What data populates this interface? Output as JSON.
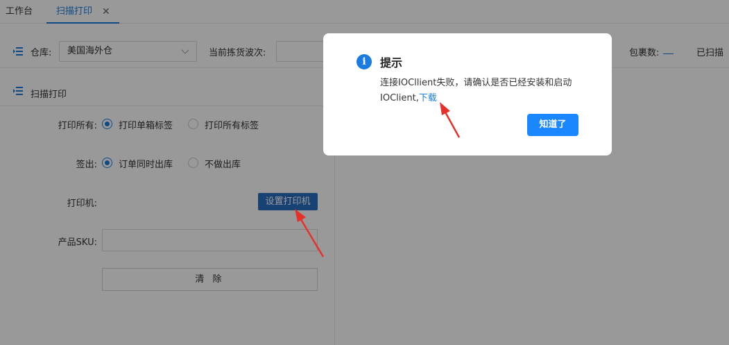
{
  "tabs": [
    {
      "label": "工作台"
    },
    {
      "label": "扫描打印",
      "close": "✕"
    }
  ],
  "filter": {
    "warehouse_label": "仓库:",
    "warehouse_value": "美国海外仓",
    "wave_label": "当前拣货波次:",
    "package_label": "包裹数:",
    "scanned_label": "已扫描"
  },
  "panel": {
    "title": "扫描打印",
    "print_all_label": "打印所有:",
    "print_options": [
      "打印单箱标签",
      "打印所有标签"
    ],
    "print_selected": "打印单箱标签",
    "checkout_label": "签出:",
    "checkout_options": [
      "订单同时出库",
      "不做出库"
    ],
    "checkout_selected": "订单同时出库",
    "printer_label": "打印机:",
    "printer_button": "设置打印机",
    "sku_label": "产品SKU:",
    "sku_value": "",
    "clear_button": "清 除"
  },
  "dialog": {
    "icon": "i",
    "title": "提示",
    "message": "连接IOCllient失败，请确认是否已经安装和启动IOClient,",
    "link": "下载",
    "ok_button": "知道了"
  },
  "colors": {
    "accent": "#1a7ce0",
    "ok_button": "#1a86ff",
    "printer_button": "#2b6fc2",
    "annotation_arrow": "#e8302a"
  },
  "icons": [
    "menu-icon",
    "chevron-down-icon",
    "close-icon",
    "info-icon",
    "radio-checked-icon",
    "radio-unchecked-icon",
    "arrow-annotation"
  ]
}
